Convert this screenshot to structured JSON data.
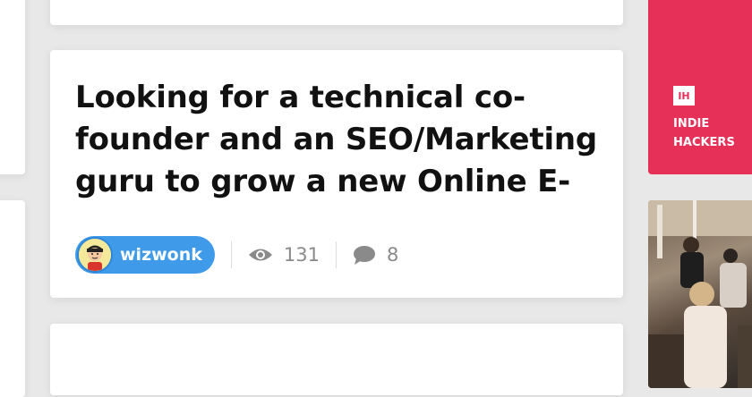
{
  "post": {
    "title": "Looking for a technical co-founder and an SEO/Marketing guru to grow a new Online E-",
    "author": "wizwonk",
    "views": "131",
    "comments": "8"
  },
  "sidebar": {
    "logo_text": "IH",
    "brand_name": "INDIE HACKERS"
  },
  "icons": {
    "views": "eye-icon",
    "comments": "speech-bubble-icon"
  },
  "colors": {
    "brand": "#e63058",
    "author_pill": "#3f9ae9"
  }
}
